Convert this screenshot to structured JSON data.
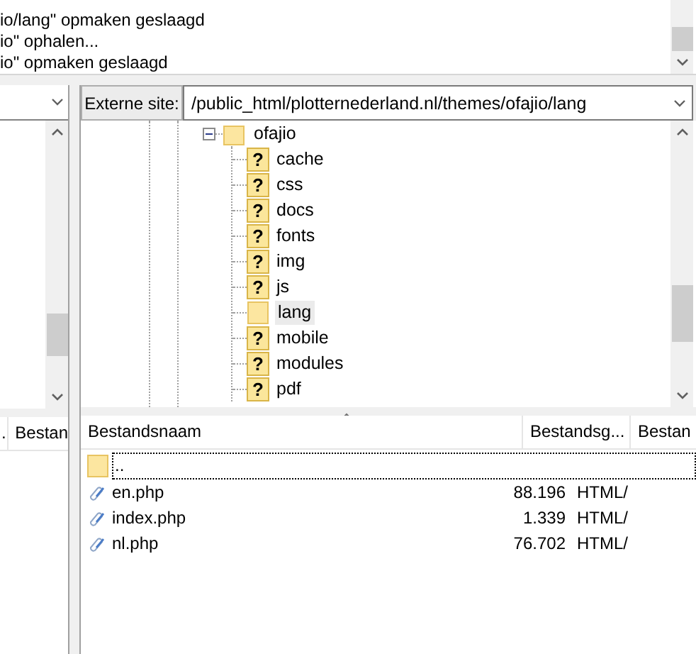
{
  "log": {
    "lines": [
      "io/lang\" opmaken geslaagd",
      "io\" ophalen...",
      "io\" opmaken geslaagd"
    ]
  },
  "local": {
    "list_columns": [
      ".",
      "Bestan"
    ]
  },
  "remote": {
    "path_label": "Externe site:",
    "path": "/public_html/plotternederland.nl/themes/ofajio/lang",
    "tree": [
      {
        "label": "ofajio",
        "expanded": true,
        "children": [
          {
            "label": "cache",
            "kind": "unknown",
            "mark": "?",
            "selected": false
          },
          {
            "label": "css",
            "kind": "unknown",
            "mark": "?",
            "selected": false
          },
          {
            "label": "docs",
            "kind": "unknown",
            "mark": "?",
            "selected": false
          },
          {
            "label": "fonts",
            "kind": "unknown",
            "mark": "?",
            "selected": false
          },
          {
            "label": "img",
            "kind": "unknown",
            "mark": "?",
            "selected": false
          },
          {
            "label": "js",
            "kind": "unknown",
            "mark": "?",
            "selected": false
          },
          {
            "label": "lang",
            "kind": "folder",
            "selected": true
          },
          {
            "label": "mobile",
            "kind": "unknown",
            "mark": "?",
            "selected": false
          },
          {
            "label": "modules",
            "kind": "unknown",
            "mark": "?",
            "selected": false
          },
          {
            "label": "pdf",
            "kind": "unknown",
            "mark": "?",
            "selected": false
          }
        ]
      }
    ],
    "files": {
      "columns": [
        "Bestandsnaam",
        "Bestandsg...",
        "Bestan"
      ],
      "rows": [
        {
          "name": "..",
          "kind": "parent",
          "focused": true
        },
        {
          "name": "en.php",
          "kind": "file",
          "size": "88.196",
          "type": "HTML/",
          "focused": false
        },
        {
          "name": "index.php",
          "kind": "file",
          "size": "1.339",
          "type": "HTML/",
          "focused": false
        },
        {
          "name": "nl.php",
          "kind": "file",
          "size": "76.702",
          "type": "HTML/",
          "focused": false
        }
      ]
    }
  }
}
